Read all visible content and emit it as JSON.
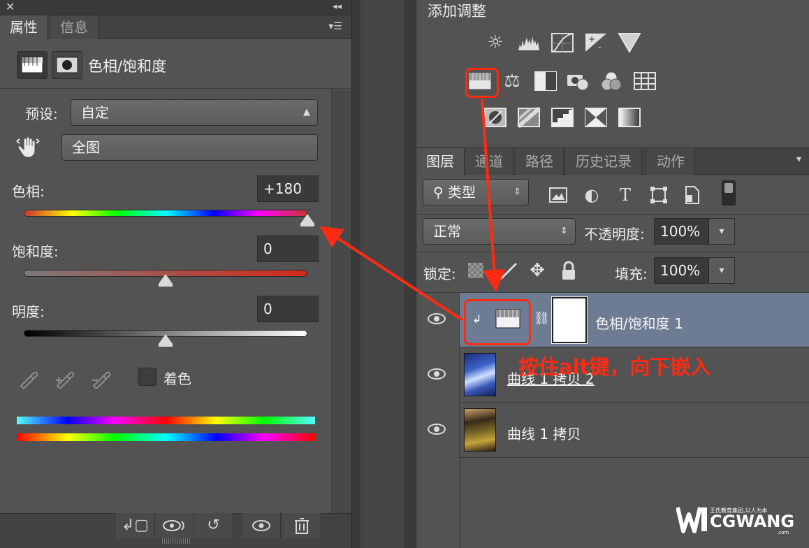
{
  "properties": {
    "tabs": [
      {
        "label": "属性",
        "active": true
      },
      {
        "label": "信息",
        "active": false
      }
    ],
    "title": "色相/饱和度",
    "preset_label": "预设:",
    "preset_value": "自定",
    "range_value": "全图",
    "hue": {
      "label": "色相:",
      "value": "+180",
      "level": 1.0
    },
    "saturation": {
      "label": "饱和度:",
      "value": "0",
      "level": 0.5
    },
    "lightness": {
      "label": "明度:",
      "value": "0",
      "level": 0.5
    },
    "colorize_label": "着色"
  },
  "adjustments": {
    "title": "添加调整"
  },
  "layers": {
    "tabs": [
      {
        "label": "图层",
        "active": true
      },
      {
        "label": "通道",
        "active": false
      },
      {
        "label": "路径",
        "active": false
      },
      {
        "label": "历史记录",
        "active": false
      },
      {
        "label": "动作",
        "active": false
      }
    ],
    "filter_type": "类型",
    "filter_text_icon": "T",
    "blend_mode": "正常",
    "opacity_label": "不透明度:",
    "opacity_value": "100%",
    "lock_label": "锁定:",
    "fill_label": "填充:",
    "fill_value": "100%",
    "rows": [
      {
        "name": "色相/饱和度 1",
        "selected": true
      },
      {
        "name": "曲线 1 拷贝 2",
        "selected": false
      },
      {
        "name": "曲线 1 拷贝",
        "selected": false
      }
    ]
  },
  "annotation": {
    "text": "按住alt键，向下嵌入",
    "color": "#ff2a12"
  },
  "watermark": {
    "brand": "CGWANG",
    "tagline": "王氏教育集团,以人为本",
    "domain": ".com"
  }
}
